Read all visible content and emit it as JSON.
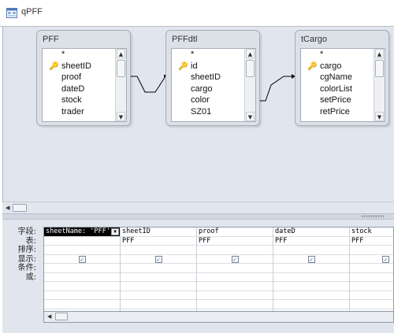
{
  "window": {
    "title": "qPFF",
    "icon": "query-icon"
  },
  "tables": [
    {
      "name": "PFF",
      "fields": [
        {
          "label": "*",
          "key": false
        },
        {
          "label": "sheetID",
          "key": true
        },
        {
          "label": "proof",
          "key": false
        },
        {
          "label": "dateD",
          "key": false
        },
        {
          "label": "stock",
          "key": false
        },
        {
          "label": "trader",
          "key": false
        }
      ]
    },
    {
      "name": "PFFdtl",
      "fields": [
        {
          "label": "*",
          "key": false
        },
        {
          "label": "id",
          "key": true
        },
        {
          "label": "sheetID",
          "key": false
        },
        {
          "label": "cargo",
          "key": false
        },
        {
          "label": "color",
          "key": false
        },
        {
          "label": "SZ01",
          "key": false
        }
      ]
    },
    {
      "name": "tCargo",
      "fields": [
        {
          "label": "*",
          "key": false
        },
        {
          "label": "cargo",
          "key": true
        },
        {
          "label": "cgName",
          "key": false
        },
        {
          "label": "colorList",
          "key": false
        },
        {
          "label": "setPrice",
          "key": false
        },
        {
          "label": "retPrice",
          "key": false
        }
      ]
    }
  ],
  "grid": {
    "row_labels": [
      "字段:",
      "表:",
      "排序:",
      "显示:",
      "条件:",
      "或:"
    ],
    "columns": [
      {
        "field": "sheetName: 'PFF'",
        "table": "",
        "show": true
      },
      {
        "field": "sheetID",
        "table": "PFF",
        "show": true
      },
      {
        "field": "proof",
        "table": "PFF",
        "show": true
      },
      {
        "field": "dateD",
        "table": "PFF",
        "show": true
      },
      {
        "field": "stock",
        "table": "PFF",
        "show": true
      }
    ]
  },
  "icons": {
    "key": "primary-key-icon",
    "checkbox": "checkbox-checked-icon"
  }
}
